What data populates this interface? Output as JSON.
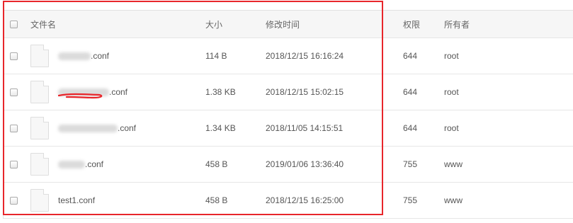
{
  "columns": {
    "name": "文件名",
    "size": "大小",
    "modified": "修改时间",
    "permissions": "权限",
    "owner": "所有者"
  },
  "files": [
    {
      "name_suffix": ".conf",
      "size": "114 B",
      "modified": "2018/12/15 16:16:24",
      "permissions": "644",
      "owner": "root"
    },
    {
      "name_suffix": ".conf",
      "size": "1.38 KB",
      "modified": "2018/12/15 15:02:15",
      "permissions": "644",
      "owner": "root"
    },
    {
      "name_suffix": ".conf",
      "size": "1.34 KB",
      "modified": "2018/11/05 14:15:51",
      "permissions": "644",
      "owner": "root"
    },
    {
      "name_suffix": ".conf",
      "size": "458 B",
      "modified": "2019/01/06 13:36:40",
      "permissions": "755",
      "owner": "www"
    },
    {
      "name_suffix": "test1.conf",
      "size": "458 B",
      "modified": "2018/12/15 16:25:00",
      "permissions": "755",
      "owner": "www"
    }
  ],
  "highlight_color": "#e8262b"
}
